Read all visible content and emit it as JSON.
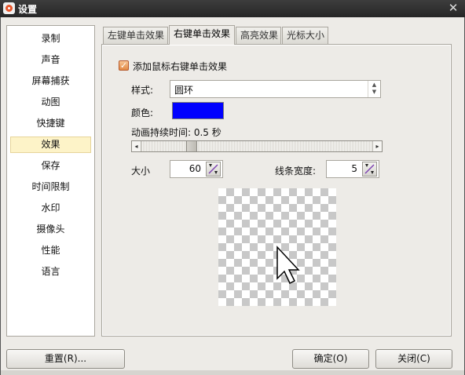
{
  "window": {
    "title": "设置"
  },
  "sidebar": {
    "items": [
      {
        "label": "录制"
      },
      {
        "label": "声音"
      },
      {
        "label": "屏幕捕获"
      },
      {
        "label": "动图"
      },
      {
        "label": "快捷键"
      },
      {
        "label": "效果"
      },
      {
        "label": "保存"
      },
      {
        "label": "时间限制"
      },
      {
        "label": "水印"
      },
      {
        "label": "摄像头"
      },
      {
        "label": "性能"
      },
      {
        "label": "语言"
      }
    ],
    "selected": "效果"
  },
  "tabs": [
    {
      "label": "左键单击效果"
    },
    {
      "label": "右键单击效果"
    },
    {
      "label": "高亮效果"
    },
    {
      "label": "光标大小"
    }
  ],
  "active_tab": "右键单击效果",
  "panel": {
    "enable_checkbox": {
      "label": "添加鼠标右键单击效果",
      "checked": true
    },
    "style": {
      "label": "样式:",
      "value": "圆环"
    },
    "color": {
      "label": "颜色:",
      "value": "#0000ff"
    },
    "duration": {
      "label": "动画持续时间: 0.5 秒",
      "value": 0.5,
      "slider_fraction": 0.2
    },
    "size": {
      "label": "大小",
      "value": "60"
    },
    "line_width": {
      "label": "线条宽度:",
      "value": "5"
    },
    "preview": {
      "icon": "cursor-arrow-icon"
    }
  },
  "buttons": {
    "reset": "重置(R)...",
    "ok": "确定(O)",
    "close": "关闭(C)"
  }
}
